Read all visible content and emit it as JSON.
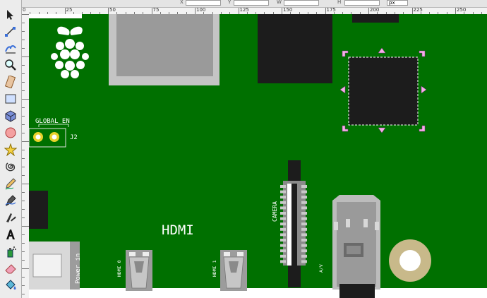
{
  "toolbar": {
    "x_label": "X",
    "y_label": "Y",
    "w_label": "W",
    "h_label": "H",
    "x_value": "",
    "y_value": "",
    "w_value": "",
    "h_value": "",
    "unit_value": "px"
  },
  "ruler": {
    "labels": [
      "0",
      "25",
      "50",
      "75",
      "100",
      "125",
      "150",
      "175",
      "200",
      "225",
      "250"
    ]
  },
  "tools": [
    {
      "name": "selector-tool-icon"
    },
    {
      "name": "node-tool-icon"
    },
    {
      "name": "tweak-tool-icon"
    },
    {
      "name": "zoom-tool-icon"
    },
    {
      "name": "measure-tool-icon"
    },
    {
      "name": "rectangle-tool-icon"
    },
    {
      "name": "3d-box-tool-icon"
    },
    {
      "name": "ellipse-tool-icon"
    },
    {
      "name": "star-tool-icon"
    },
    {
      "name": "spiral-tool-icon"
    },
    {
      "name": "pencil-tool-icon"
    },
    {
      "name": "pen-tool-icon"
    },
    {
      "name": "calligraphy-tool-icon"
    },
    {
      "name": "text-tool-icon"
    },
    {
      "name": "spray-tool-icon"
    },
    {
      "name": "eraser-tool-icon"
    },
    {
      "name": "paint-bucket-tool-icon"
    }
  ],
  "board": {
    "pcb_color": "#007000",
    "labels": {
      "global_en": "GLOBAL_EN",
      "j2": "J2",
      "hdmi": "HDMI",
      "camera": "CAMERA",
      "power_in": "Power in",
      "hdmi0": "HDMI 0",
      "hdmi1": "HDMI 1",
      "av": "A/V"
    }
  }
}
